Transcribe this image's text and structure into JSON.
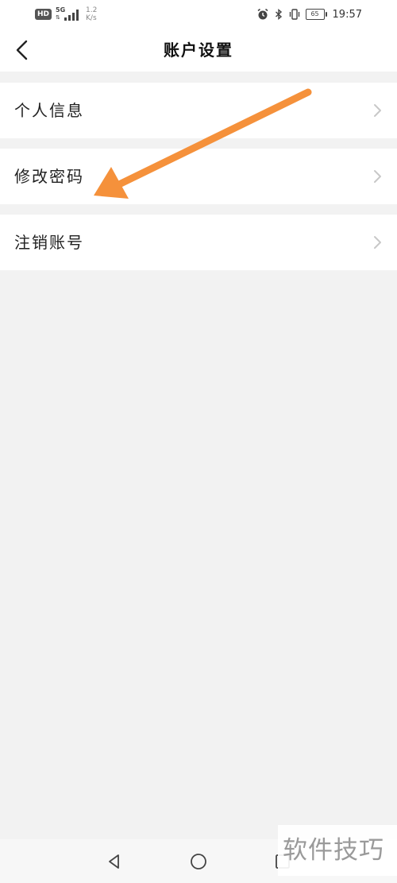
{
  "status_bar": {
    "hd": "HD",
    "network": "5G",
    "speed_value": "1.2",
    "speed_unit": "K/s",
    "battery": "65",
    "time": "19:57"
  },
  "header": {
    "title": "账户设置",
    "back_icon": "chevron-left-icon"
  },
  "menu": {
    "items": [
      {
        "label": "个人信息",
        "icon": "chevron-right-icon"
      },
      {
        "label": "修改密码",
        "icon": "chevron-right-icon"
      },
      {
        "label": "注销账号",
        "icon": "chevron-right-icon"
      }
    ]
  },
  "annotation": {
    "color": "#f5913b",
    "points_to": "修改密码"
  },
  "nav_bar": {
    "back_icon": "triangle-back-icon",
    "home_icon": "circle-home-icon",
    "recent_icon": "square-recent-icon"
  },
  "watermark": "软件技巧",
  "colors": {
    "background": "#f2f2f2",
    "surface": "#ffffff",
    "text": "#222222",
    "chevron": "#c8c8c8"
  }
}
